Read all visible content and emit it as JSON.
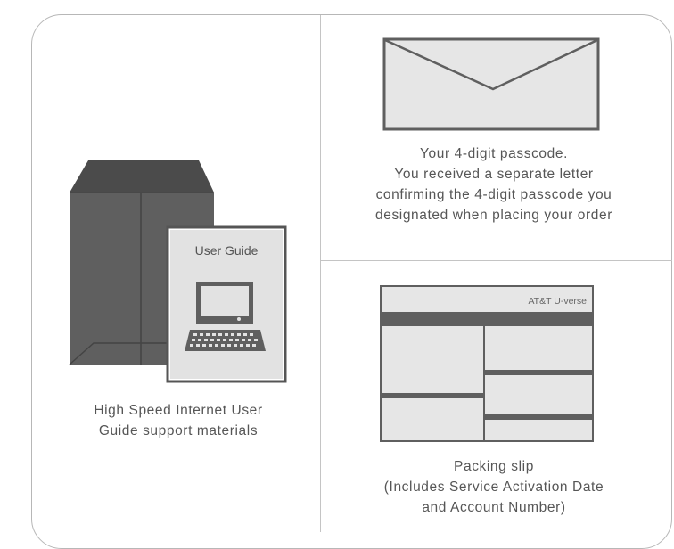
{
  "guide": {
    "label": "User Guide",
    "caption_lines": [
      "High Speed Internet User",
      "Guide support materials"
    ]
  },
  "envelope": {
    "caption_lines": [
      "Your 4-digit passcode.",
      "You received a separate letter",
      "confirming the 4-digit passcode you",
      "designated when placing your order"
    ]
  },
  "packing_slip": {
    "brand": "AT&T U-verse",
    "caption_lines": [
      "Packing slip",
      "(Includes Service Activation Date",
      "and Account Number)"
    ]
  },
  "colors": {
    "border": "#b7b7b7",
    "dark_gray": "#5f5f5f",
    "folder_top": "#4a4a4a",
    "light_fill": "#e6e6e6",
    "text": "#565656"
  }
}
